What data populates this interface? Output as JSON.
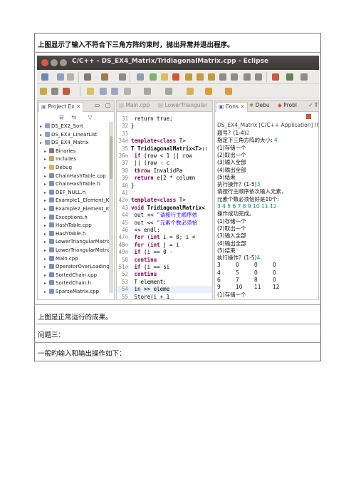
{
  "doc": {
    "caption_top": "上图显示了输入不符合下三角方阵约束时，抛出异常并退出程序。",
    "caption_bottom": "上图是正常运行的成果。",
    "heading": "问题三：",
    "body": "一般旳输入和输出操作如下："
  },
  "window": {
    "title": "C/C++ - DS_EX4_Matrix/TridiagonalMatrix.cpp - Eclipse"
  },
  "project_explorer": {
    "tab_label": "Project Ex",
    "items": [
      {
        "label": "DS_EX2_Sort",
        "indent": 0,
        "icon": "project-icon"
      },
      {
        "label": "DS_EX3_LinearList",
        "indent": 0,
        "icon": "project-icon"
      },
      {
        "label": "DS_EX4_Matrix",
        "indent": 0,
        "icon": "project-icon"
      },
      {
        "label": "Binaries",
        "indent": 1,
        "icon": "binaries-icon"
      },
      {
        "label": "Includes",
        "indent": 1,
        "icon": "includes-icon"
      },
      {
        "label": "Debug",
        "indent": 1,
        "icon": "folder-icon"
      },
      {
        "label": "ChainHashTable.cpp",
        "indent": 1,
        "icon": "cpp-file-icon"
      },
      {
        "label": "ChainHashTable.h",
        "indent": 1,
        "icon": "h-file-icon"
      },
      {
        "label": "DEF_NULL.h",
        "indent": 1,
        "icon": "h-file-icon"
      },
      {
        "label": "Example1_Element_Ke",
        "indent": 1,
        "icon": "h-file-icon"
      },
      {
        "label": "Example2_Element_Ke",
        "indent": 1,
        "icon": "h-file-icon"
      },
      {
        "label": "Exceptions.h",
        "indent": 1,
        "icon": "h-file-icon"
      },
      {
        "label": "HashTable.cpp",
        "indent": 1,
        "icon": "cpp-file-icon"
      },
      {
        "label": "HashTable.h",
        "indent": 1,
        "icon": "h-file-icon"
      },
      {
        "label": "LowerTriangularMatrix",
        "indent": 1,
        "icon": "cpp-file-icon"
      },
      {
        "label": "LowerTriangularMatrix",
        "indent": 1,
        "icon": "h-file-icon"
      },
      {
        "label": "Main.cpp",
        "indent": 1,
        "icon": "cpp-file-icon"
      },
      {
        "label": "OperatorOverLoading.",
        "indent": 1,
        "icon": "cpp-file-icon"
      },
      {
        "label": "SortedChain.cpp",
        "indent": 1,
        "icon": "cpp-file-icon"
      },
      {
        "label": "SortedChain.h",
        "indent": 1,
        "icon": "h-file-icon"
      },
      {
        "label": "SparseMatrix.cpp",
        "indent": 1,
        "icon": "cpp-file-icon"
      }
    ]
  },
  "editor": {
    "tabs": [
      "Main.cpp",
      "LowerTriangular",
      "Tri"
    ],
    "lines": [
      {
        "n": "31",
        "parts": [
          {
            "t": "        return  true;",
            "c": ""
          }
        ]
      },
      {
        "n": "32",
        "parts": [
          {
            "t": "}",
            "c": ""
          }
        ]
      },
      {
        "n": "33",
        "parts": [
          {
            "t": "",
            "c": ""
          }
        ]
      },
      {
        "n": "34⊖",
        "parts": [
          {
            "t": "template",
            "c": "kw"
          },
          {
            "t": "<",
            "c": ""
          },
          {
            "t": "class",
            "c": "kw"
          },
          {
            "t": " T>",
            "c": ""
          }
        ]
      },
      {
        "n": "35",
        "parts": [
          {
            "t": "T TridiagonalMatrix<T>::",
            "c": "b"
          }
        ]
      },
      {
        "n": "36⊖",
        "parts": [
          {
            "t": "    if",
            "c": "kw"
          },
          {
            "t": " (row < 1 || row",
            "c": ""
          }
        ]
      },
      {
        "n": "37",
        "parts": [
          {
            "t": "            || (row - c",
            "c": ""
          }
        ]
      },
      {
        "n": "38",
        "parts": [
          {
            "t": "        throw",
            "c": "kw"
          },
          {
            "t": " InvalidPa",
            "c": ""
          }
        ]
      },
      {
        "n": "39",
        "parts": [
          {
            "t": "    return",
            "c": "kw"
          },
          {
            "t": " e[2 * column",
            "c": ""
          }
        ]
      },
      {
        "n": "40",
        "parts": [
          {
            "t": "}",
            "c": ""
          }
        ]
      },
      {
        "n": "41",
        "parts": [
          {
            "t": "",
            "c": ""
          }
        ]
      },
      {
        "n": "42⊖",
        "parts": [
          {
            "t": "template",
            "c": "kw"
          },
          {
            "t": "<",
            "c": ""
          },
          {
            "t": "class",
            "c": "kw"
          },
          {
            "t": " T>",
            "c": ""
          }
        ]
      },
      {
        "n": "43",
        "parts": [
          {
            "t": "void",
            "c": "kw"
          },
          {
            "t": " TridiagonalMatrix<",
            "c": "b"
          }
        ]
      },
      {
        "n": "44",
        "parts": [
          {
            "t": "    out << ",
            "c": ""
          },
          {
            "t": "\"请按行主顺序依",
            "c": "str"
          }
        ]
      },
      {
        "n": "45",
        "parts": [
          {
            "t": "    out << ",
            "c": ""
          },
          {
            "t": "\"元素个数必须恰",
            "c": "str"
          }
        ]
      },
      {
        "n": "46",
        "parts": [
          {
            "t": "            << endl;",
            "c": ""
          }
        ]
      },
      {
        "n": "47⊖",
        "parts": [
          {
            "t": "    for",
            "c": "kw"
          },
          {
            "t": " (",
            "c": ""
          },
          {
            "t": "int",
            "c": "kw"
          },
          {
            "t": " i = 0; i <",
            "c": ""
          }
        ]
      },
      {
        "n": "48⊖",
        "parts": [
          {
            "t": "        for",
            "c": "kw"
          },
          {
            "t": " (",
            "c": ""
          },
          {
            "t": "int",
            "c": "kw"
          },
          {
            "t": " j = i",
            "c": ""
          }
        ]
      },
      {
        "n": "49⊖",
        "parts": [
          {
            "t": "            if",
            "c": "kw"
          },
          {
            "t": " (i == 0 -",
            "c": ""
          }
        ]
      },
      {
        "n": "50",
        "parts": [
          {
            "t": "                continu",
            "c": "kw"
          }
        ]
      },
      {
        "n": "51⊖",
        "parts": [
          {
            "t": "            if",
            "c": "kw"
          },
          {
            "t": " (i == si",
            "c": ""
          }
        ]
      },
      {
        "n": "52",
        "parts": [
          {
            "t": "                continu",
            "c": "kw"
          }
        ]
      },
      {
        "n": "53",
        "parts": [
          {
            "t": "            T element;",
            "c": ""
          }
        ]
      },
      {
        "n": "54",
        "parts": [
          {
            "t": "            in >> eleme",
            "c": ""
          }
        ]
      },
      {
        "n": "55",
        "parts": [
          {
            "t": "            Store(i + 1",
            "c": ""
          }
        ]
      },
      {
        "n": "56",
        "parts": [
          {
            "t": "        }",
            "c": ""
          }
        ]
      }
    ]
  },
  "console": {
    "tabs": [
      "Cons",
      "Debu",
      "Probl",
      "T"
    ],
    "header": "DS_EX4_Matrix [C/C++ Application] /hon",
    "lines": [
      {
        "segs": [
          {
            "t": "题号？(1-4)",
            "c": ""
          },
          {
            "t": "2",
            "c": "inp"
          }
        ]
      },
      {
        "segs": [
          {
            "t": "指定下三角方阵的大小: ",
            "c": ""
          },
          {
            "t": "4",
            "c": "inp"
          }
        ]
      },
      {
        "segs": [
          {
            "t": "(1)存储一个",
            "c": ""
          }
        ]
      },
      {
        "segs": [
          {
            "t": "(2)取出一个",
            "c": ""
          }
        ]
      },
      {
        "segs": [
          {
            "t": "(3)输入全部",
            "c": ""
          }
        ]
      },
      {
        "segs": [
          {
            "t": "(4)输出全部",
            "c": ""
          }
        ]
      },
      {
        "segs": [
          {
            "t": "(5)结束",
            "c": ""
          }
        ]
      },
      {
        "segs": [
          {
            "t": "执行操作？(1-5)",
            "c": ""
          },
          {
            "t": "3",
            "c": "inp"
          }
        ]
      },
      {
        "segs": [
          {
            "t": "请按行主顺序依次输入元素，",
            "c": ""
          }
        ]
      },
      {
        "segs": [
          {
            "t": "元素个数必须恰好是10个:",
            "c": ""
          }
        ]
      },
      {
        "segs": [
          {
            "t": "3 4 5 6 7 8 9 10 11 12",
            "c": "inp"
          }
        ]
      },
      {
        "segs": [
          {
            "t": "操作成功完成。",
            "c": ""
          }
        ]
      },
      {
        "segs": [
          {
            "t": "(1)存储一个",
            "c": ""
          }
        ]
      },
      {
        "segs": [
          {
            "t": "(2)取出一个",
            "c": ""
          }
        ]
      },
      {
        "segs": [
          {
            "t": "(3)输入全部",
            "c": ""
          }
        ]
      },
      {
        "segs": [
          {
            "t": "(4)输出全部",
            "c": ""
          }
        ]
      },
      {
        "segs": [
          {
            "t": "(5)结束",
            "c": ""
          }
        ]
      },
      {
        "segs": [
          {
            "t": "执行操作？(1-5)",
            "c": ""
          },
          {
            "t": "4",
            "c": "inp"
          }
        ]
      }
    ],
    "matrix": [
      [
        "3",
        "0",
        "0",
        "0"
      ],
      [
        "4",
        "5",
        "0",
        "0"
      ],
      [
        "6",
        "7",
        "8",
        "0"
      ],
      [
        "9",
        "10",
        "11",
        "12"
      ]
    ],
    "trailing": "(1)存储一个"
  }
}
